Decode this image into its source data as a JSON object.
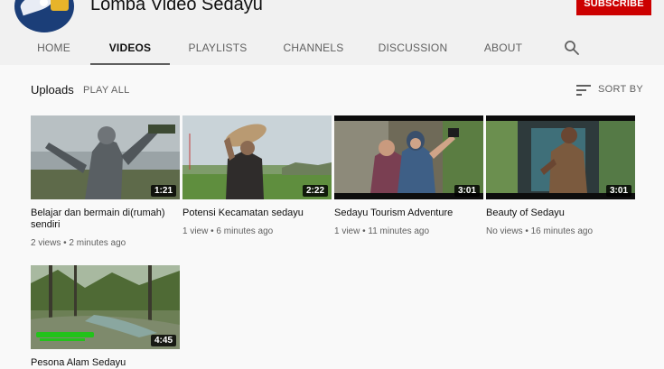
{
  "channel": {
    "name": "Lomba Video Sedayu",
    "subscribe_label": "SUBSCRIBE"
  },
  "tabs": [
    {
      "label": "HOME",
      "active": false
    },
    {
      "label": "VIDEOS",
      "active": true
    },
    {
      "label": "PLAYLISTS",
      "active": false
    },
    {
      "label": "CHANNELS",
      "active": false
    },
    {
      "label": "DISCUSSION",
      "active": false
    },
    {
      "label": "ABOUT",
      "active": false
    }
  ],
  "section": {
    "title": "Uploads",
    "play_all_label": "PLAY ALL",
    "sort_label": "SORT BY"
  },
  "videos": [
    {
      "title": "Belajar dan bermain di(rumah) sendiri",
      "duration": "1:21",
      "views": "2 views",
      "age": "2 minutes ago",
      "meta": "2 views • 2 minutes ago"
    },
    {
      "title": "Potensi Kecamatan sedayu",
      "duration": "2:22",
      "views": "1 view",
      "age": "6 minutes ago",
      "meta": "1 view • 6 minutes ago"
    },
    {
      "title": "Sedayu Tourism Adventure",
      "duration": "3:01",
      "views": "1 view",
      "age": "11 minutes ago",
      "meta": "1 view • 11 minutes ago"
    },
    {
      "title": "Beauty of Sedayu",
      "duration": "3:01",
      "views": "No views",
      "age": "16 minutes ago",
      "meta": "No views • 16 minutes ago"
    },
    {
      "title": "Pesona Alam Sedayu",
      "duration": "4:45",
      "views": "",
      "age": "",
      "meta": ""
    }
  ],
  "colors": {
    "accent_red": "#cc0000",
    "text_primary": "#0f0f0f",
    "text_secondary": "#606060",
    "page_background": "#f9f9f9",
    "header_background": "#f1f1f1"
  },
  "icons": {
    "search": "search-icon",
    "sort": "sort-icon"
  }
}
